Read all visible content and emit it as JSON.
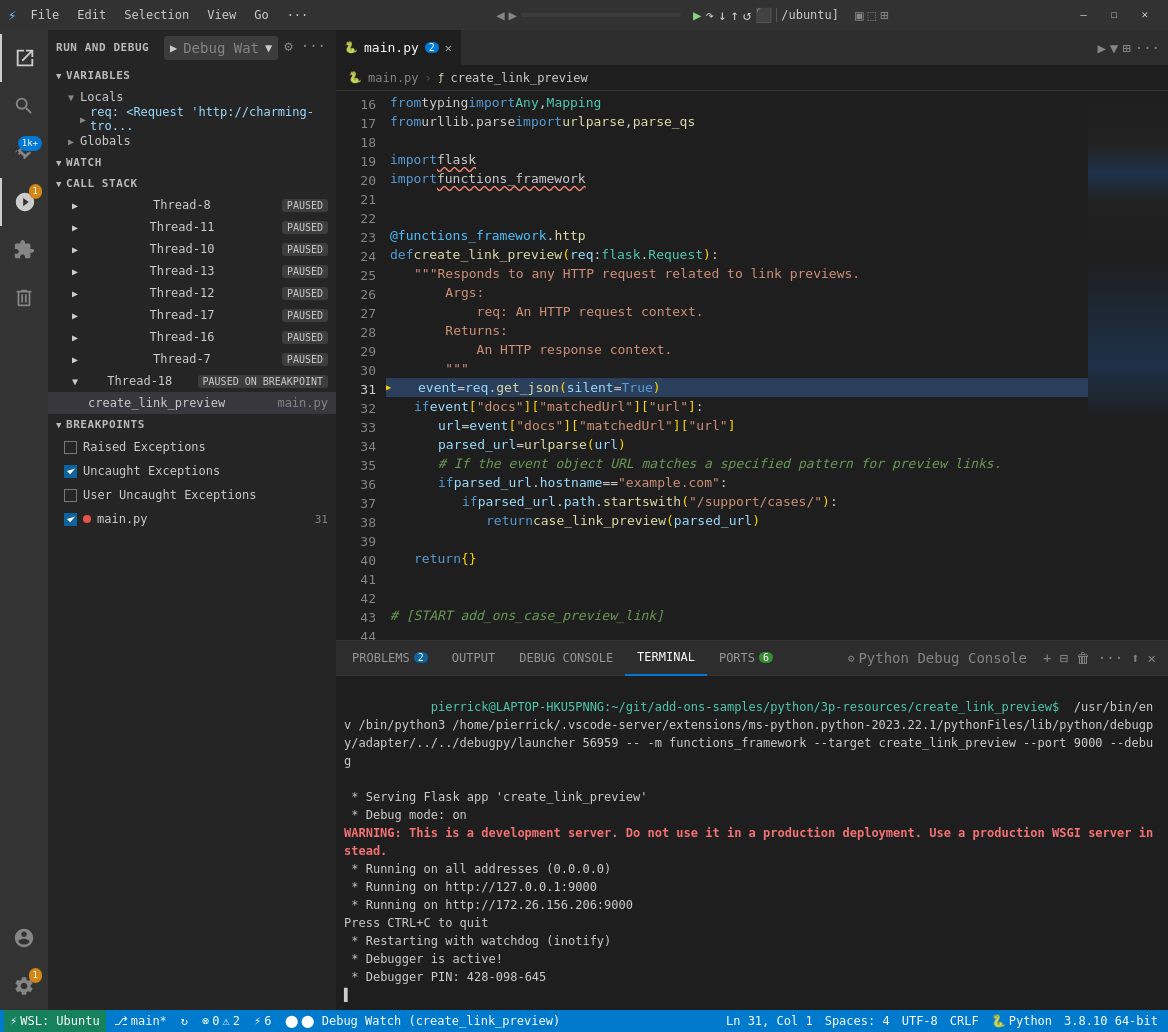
{
  "titlebar": {
    "icon": "⚡",
    "menus": [
      "File",
      "Edit",
      "Selection",
      "View",
      "Go",
      "···"
    ],
    "debug_controls": [
      "◀",
      "▶",
      "⏸",
      "⏹",
      "↻",
      "⬛",
      "⬜"
    ],
    "breadcrumb": "/ubuntu]",
    "window_controls": [
      "—",
      "☐",
      "✕"
    ]
  },
  "sidebar": {
    "run_debug_title": "RUN AND DEBUG",
    "debug_config": "Debug Wat",
    "sections": {
      "variables": "VARIABLES",
      "locals": "Locals",
      "globals": "Globals",
      "watch": "WATCH",
      "call_stack": "CALL STACK",
      "breakpoints": "BREAKPOINTS"
    },
    "req_value": "req: <Request 'http://charming-tro...",
    "threads": [
      {
        "name": "Thread-8",
        "status": "PAUSED"
      },
      {
        "name": "Thread-11",
        "status": "PAUSED"
      },
      {
        "name": "Thread-10",
        "status": "PAUSED"
      },
      {
        "name": "Thread-13",
        "status": "PAUSED"
      },
      {
        "name": "Thread-12",
        "status": "PAUSED"
      },
      {
        "name": "Thread-17",
        "status": "PAUSED"
      },
      {
        "name": "Thread-16",
        "status": "PAUSED"
      },
      {
        "name": "Thread-7",
        "status": "PAUSED"
      },
      {
        "name": "Thread-18",
        "status": "PAUSED ON BREAKPOINT"
      }
    ],
    "call_stack_item": {
      "name": "create_link_preview",
      "file": "main.py"
    },
    "breakpoints": [
      {
        "label": "Raised Exceptions",
        "checked": false
      },
      {
        "label": "Uncaught Exceptions",
        "checked": true
      },
      {
        "label": "User Uncaught Exceptions",
        "checked": false
      },
      {
        "label": "main.py",
        "checked": true,
        "hasDot": true,
        "lineNum": "31"
      }
    ]
  },
  "editor": {
    "tab_name": "main.py",
    "tab_modified": "2",
    "breadcrumb_file": "main.py",
    "breadcrumb_fn": "create_link_preview",
    "lines": [
      {
        "num": "16",
        "content": "from typing import Any, Mapping"
      },
      {
        "num": "17",
        "content": "from urllib.parse import urlparse, parse_qs"
      },
      {
        "num": "18",
        "content": ""
      },
      {
        "num": "19",
        "content": "import flask"
      },
      {
        "num": "20",
        "content": "import functions_framework"
      },
      {
        "num": "21",
        "content": ""
      },
      {
        "num": "22",
        "content": ""
      },
      {
        "num": "23",
        "content": "@functions_framework.http"
      },
      {
        "num": "24",
        "content": "def create_link_preview(req: flask.Request):"
      },
      {
        "num": "25",
        "content": "    \"\"\"Responds to any HTTP request related to link previews."
      },
      {
        "num": "26",
        "content": "    Args:"
      },
      {
        "num": "27",
        "content": "        req: An HTTP request context."
      },
      {
        "num": "28",
        "content": "    Returns:"
      },
      {
        "num": "29",
        "content": "        An HTTP response context."
      },
      {
        "num": "30",
        "content": "    \"\"\""
      },
      {
        "num": "31",
        "content": "    event = req.get_json(silent=True)",
        "isDebug": true
      },
      {
        "num": "32",
        "content": "    if event[\"docs\"][\"matchedUrl\"][\"url\"]:"
      },
      {
        "num": "33",
        "content": "        url = event[\"docs\"][\"matchedUrl\"][\"url\"]"
      },
      {
        "num": "34",
        "content": "        parsed_url = urlparse(url)"
      },
      {
        "num": "35",
        "content": "        # If the event object URL matches a specified pattern for preview links."
      },
      {
        "num": "36",
        "content": "        if parsed_url.hostname == \"example.com\":"
      },
      {
        "num": "37",
        "content": "            if parsed_url.path.startswith(\"/support/cases/\"):"
      },
      {
        "num": "38",
        "content": "                return case_link_preview(parsed_url)"
      },
      {
        "num": "39",
        "content": ""
      },
      {
        "num": "40",
        "content": "    return {}"
      },
      {
        "num": "41",
        "content": ""
      },
      {
        "num": "42",
        "content": ""
      },
      {
        "num": "43",
        "content": "# [START add_ons_case_preview_link]"
      },
      {
        "num": "44",
        "content": ""
      }
    ]
  },
  "panel": {
    "tabs": [
      {
        "label": "PROBLEMS",
        "badge": "2",
        "active": false
      },
      {
        "label": "OUTPUT",
        "badge": null,
        "active": false
      },
      {
        "label": "DEBUG CONSOLE",
        "badge": null,
        "active": false
      },
      {
        "label": "TERMINAL",
        "badge": null,
        "active": true
      },
      {
        "label": "PORTS",
        "badge": "6",
        "active": false
      }
    ],
    "python_console": "Python Debug Console",
    "terminal_content": [
      {
        "type": "prompt",
        "text": "pierrick@LAPTOP-HKU5PNNG:~/git/add-ons-samples/python/3p-resources/create_link_preview$  /usr/bin/env /bin/python3 /home/pierrick/.vscode-server/extensions/ms-python.python-2023.22.1/pythonFiles/lib/python/debugpy/adapter/../../debugpy/launcher 56959 -- -m functions_framework --target create_link_preview --port 9000 --debug"
      },
      {
        "type": "normal",
        "text": " * Serving Flask app 'create_link_preview'"
      },
      {
        "type": "normal",
        "text": " * Debug mode: on"
      },
      {
        "type": "warning",
        "text": "WARNING: This is a development server. Do not use it in a production deployment. Use a production WSGI server instead."
      },
      {
        "type": "normal",
        "text": " * Running on all addresses (0.0.0.0)"
      },
      {
        "type": "normal",
        "text": " * Running on http://127.0.0.1:9000"
      },
      {
        "type": "normal",
        "text": " * Running on http://172.26.156.206:9000"
      },
      {
        "type": "normal",
        "text": "Press CTRL+C to quit"
      },
      {
        "type": "normal",
        "text": " * Restarting with watchdog (inotify)"
      },
      {
        "type": "normal",
        "text": " * Debugger is active!"
      },
      {
        "type": "normal",
        "text": " * Debugger PIN: 428-098-645"
      },
      {
        "type": "cursor",
        "text": "▌"
      }
    ]
  },
  "statusbar": {
    "wsl": "WSL: Ubuntu",
    "branch": "main*",
    "sync": "⟳",
    "errors": "⊘ 0",
    "warnings": "⚠ 2",
    "remote": "⚡ 6",
    "debug_status": "⬤ Debug Watch (create_link_preview)",
    "right": {
      "position": "Ln 31, Col 1",
      "spaces": "Spaces: 4",
      "encoding": "UTF-8",
      "line_ending": "CRLF",
      "language": "Python",
      "version": "3.8.10 64-bit"
    }
  }
}
